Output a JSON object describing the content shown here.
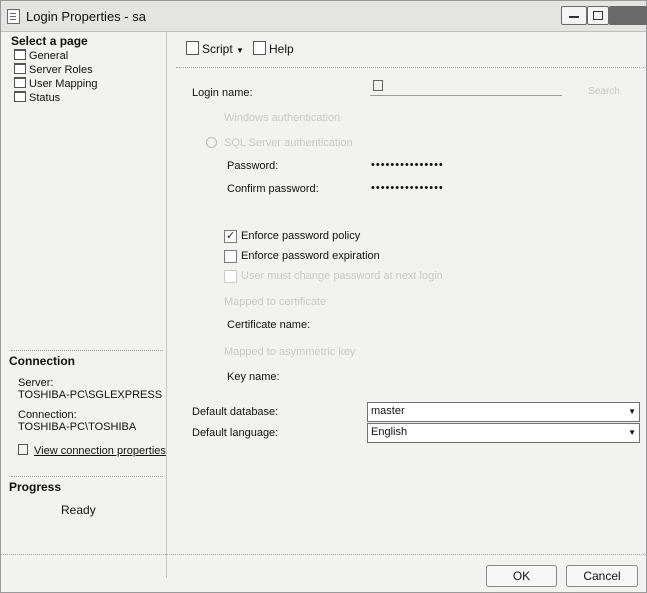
{
  "window": {
    "title": "Login Properties - sa"
  },
  "left_panel": {
    "select_page_title": "Select a page",
    "pages": [
      {
        "label": "General"
      },
      {
        "label": "Server Roles"
      },
      {
        "label": "User Mapping"
      },
      {
        "label": "Status"
      }
    ],
    "connection_title": "Connection",
    "server_label": "Server:",
    "server_value": "TOSHIBA-PC\\SGLEXPRESS",
    "connection_label": "Connection:",
    "connection_value": "TOSHIBA-PC\\TOSHIBA",
    "view_connection_link": "View connection properties",
    "progress_title": "Progress",
    "progress_status": "Ready"
  },
  "toolbar": {
    "script_label": "Script",
    "help_label": "Help"
  },
  "form": {
    "login_name_label": "Login name:",
    "search_button": "Search",
    "windows_auth_label": "Windows authentication",
    "sql_auth_label": "SQL Server authentication",
    "password_label": "Password:",
    "password_value": "•••••••••••••••",
    "confirm_password_label": "Confirm password:",
    "confirm_password_value": "•••••••••••••••",
    "enforce_policy_label": "Enforce password policy",
    "enforce_expiration_label": "Enforce password expiration",
    "must_change_label": "User must change password at next login",
    "mapped_to_certificate_label": "Mapped to certificate",
    "certificate_name_label": "Certificate name:",
    "mapped_to_asym_key_label": "Mapped to asymmetric key",
    "key_name_label": "Key name:",
    "default_database_label": "Default database:",
    "default_database_value": "master",
    "default_language_label": "Default language:",
    "default_language_value": "English"
  },
  "buttons": {
    "ok": "OK",
    "cancel": "Cancel"
  }
}
